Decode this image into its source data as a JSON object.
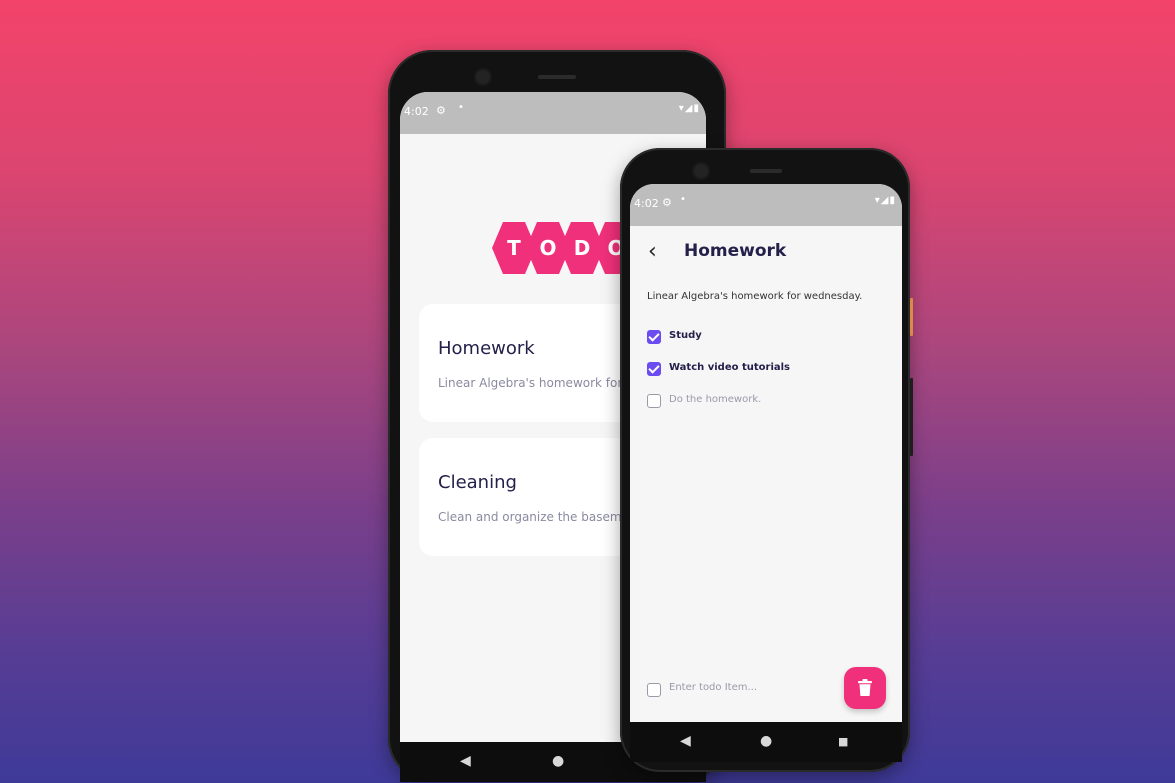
{
  "back_phone": {
    "status": {
      "time": "4:02",
      "dot": "•",
      "system_icons": "▾◢▮"
    },
    "logo_letters": [
      "T",
      "O",
      "D",
      "O"
    ],
    "cards": [
      {
        "title": "Homework",
        "description": "Linear Algebra's homework for we"
      },
      {
        "title": "Cleaning",
        "description": "Clean and organize the basement"
      }
    ],
    "nav": {
      "back": "◀",
      "home": "●"
    }
  },
  "front_phone": {
    "status": {
      "time": "4:02",
      "dot": "•",
      "system_icons": "▾◢▮"
    },
    "header": {
      "back_glyph": "‹",
      "title": "Homework"
    },
    "description": "Linear Algebra's homework for wednesday.",
    "todos": [
      {
        "label": "Study",
        "checked": true
      },
      {
        "label": "Watch video tutorials",
        "checked": true
      },
      {
        "label": "Do the homework.",
        "checked": false
      }
    ],
    "new_item": {
      "placeholder": "Enter todo Item..."
    },
    "delete_icon": "trash-icon",
    "nav": {
      "back": "◀",
      "home": "●",
      "recents": "■"
    }
  },
  "colors": {
    "accent": "#f0307a",
    "checkbox": "#6a4cf0",
    "title_text": "#24204a",
    "background_top": "#f3436a",
    "background_bottom": "#3e3a98"
  }
}
